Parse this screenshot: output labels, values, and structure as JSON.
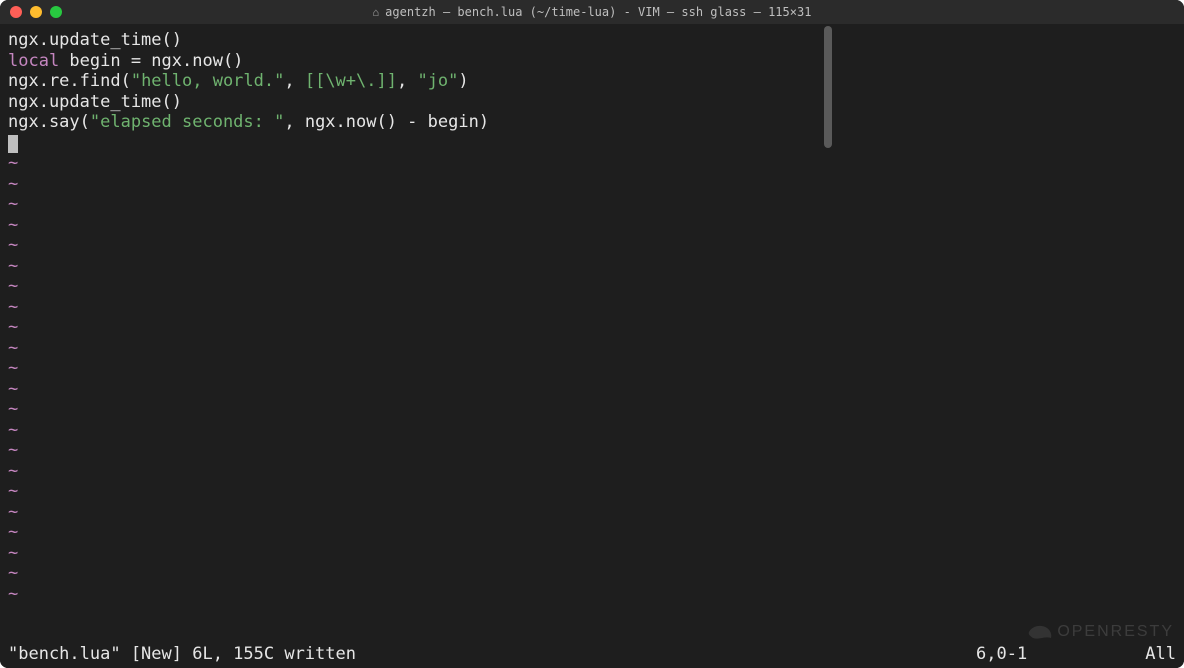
{
  "window": {
    "title": "agentzh — bench.lua (~/time-lua) - VIM — ssh glass — 115×31",
    "traffic": {
      "close": "#ff5f57",
      "min": "#febc2e",
      "max": "#28c840"
    }
  },
  "code": {
    "lines": [
      {
        "tokens": [
          {
            "t": "ngx.update_time()",
            "c": "fn"
          }
        ]
      },
      {
        "tokens": [
          {
            "t": "local",
            "c": "kw"
          },
          {
            "t": " begin = ngx.now()",
            "c": "fn"
          }
        ]
      },
      {
        "tokens": [
          {
            "t": "ngx.re.find(",
            "c": "fn"
          },
          {
            "t": "\"hello, world.\"",
            "c": "str"
          },
          {
            "t": ", ",
            "c": "punct"
          },
          {
            "t": "[[\\w+\\.]]",
            "c": "str"
          },
          {
            "t": ", ",
            "c": "punct"
          },
          {
            "t": "\"jo\"",
            "c": "str"
          },
          {
            "t": ")",
            "c": "punct"
          }
        ]
      },
      {
        "tokens": [
          {
            "t": "ngx.update_time()",
            "c": "fn"
          }
        ]
      },
      {
        "tokens": [
          {
            "t": "ngx.say(",
            "c": "fn"
          },
          {
            "t": "\"elapsed seconds: \"",
            "c": "str"
          },
          {
            "t": ", ngx.now() - begin)",
            "c": "fn"
          }
        ]
      }
    ],
    "tilde_rows": 22,
    "tilde_char": "~"
  },
  "status": {
    "left": "\"bench.lua\" [New] 6L, 155C written",
    "pos": "6,0-1",
    "right": "All"
  },
  "watermark": "OPENRESTY"
}
